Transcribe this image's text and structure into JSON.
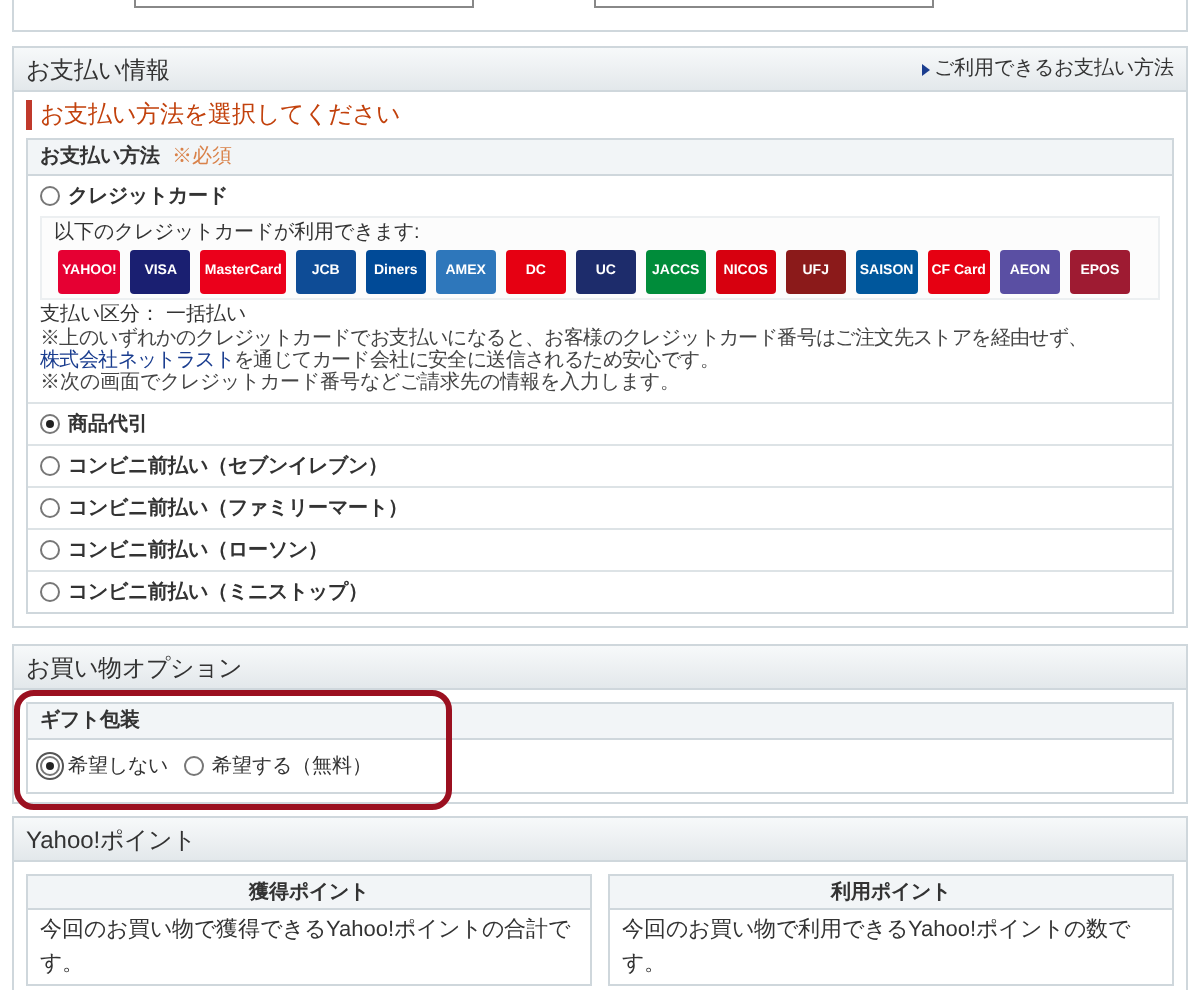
{
  "payment": {
    "title": "お支払い情報",
    "link": "ご利用できるお支払い方法",
    "prompt": "お支払い方法を選択してください",
    "section_label": "お支払い方法",
    "required": "※必須",
    "options": [
      {
        "label": "クレジットカード",
        "selected": false,
        "details": {
          "intro": "以下のクレジットカードが利用できます:",
          "cards": [
            {
              "label": "YAHOO!",
              "color": "#e60033"
            },
            {
              "label": "VISA",
              "color": "#1a1f71"
            },
            {
              "label": "MasterCard",
              "color": "#eb001b"
            },
            {
              "label": "JCB",
              "color": "#0e4c96"
            },
            {
              "label": "Diners",
              "color": "#004a97"
            },
            {
              "label": "AMEX",
              "color": "#2e77bb"
            },
            {
              "label": "DC",
              "color": "#e60012"
            },
            {
              "label": "UC",
              "color": "#1d2c6b"
            },
            {
              "label": "JACCS",
              "color": "#008c3a"
            },
            {
              "label": "NICOS",
              "color": "#d7000f"
            },
            {
              "label": "UFJ",
              "color": "#8b1a1a"
            },
            {
              "label": "SAISON",
              "color": "#00579c"
            },
            {
              "label": "CF Card",
              "color": "#e60012"
            },
            {
              "label": "AEON",
              "color": "#5a4fa3"
            },
            {
              "label": "EPOS",
              "color": "#9e1b32"
            }
          ],
          "installment": "支払い区分： 一括払い",
          "note_before": "※上のいずれかのクレジットカードでお支払いになると、お客様のクレジットカード番号はご注文先ストアを経由せず、",
          "note_link": "株式会社ネットラスト",
          "note_after": "を通じてカード会社に安全に送信されるため安心です。",
          "note2": "※次の画面でクレジットカード番号などご請求先の情報を入力します。"
        }
      },
      {
        "label": "商品代引",
        "selected": true
      },
      {
        "label": "コンビニ前払い（セブンイレブン）",
        "selected": false
      },
      {
        "label": "コンビニ前払い（ファミリーマート）",
        "selected": false
      },
      {
        "label": "コンビニ前払い（ローソン）",
        "selected": false
      },
      {
        "label": "コンビニ前払い（ミニストップ）",
        "selected": false
      }
    ]
  },
  "shopping_options": {
    "title": "お買い物オプション",
    "gift_label": "ギフト包装",
    "options": [
      {
        "label": "希望しない",
        "selected": true
      },
      {
        "label": "希望する（無料）",
        "selected": false
      }
    ]
  },
  "points": {
    "title": "Yahoo!ポイント",
    "columns": [
      {
        "heading": "獲得ポイント",
        "text": "今回のお買い物で獲得できるYahoo!ポイントの合計です。"
      },
      {
        "heading": "利用ポイント",
        "text": "今回のお買い物で利用できるYahoo!ポイントの数です。"
      }
    ]
  }
}
